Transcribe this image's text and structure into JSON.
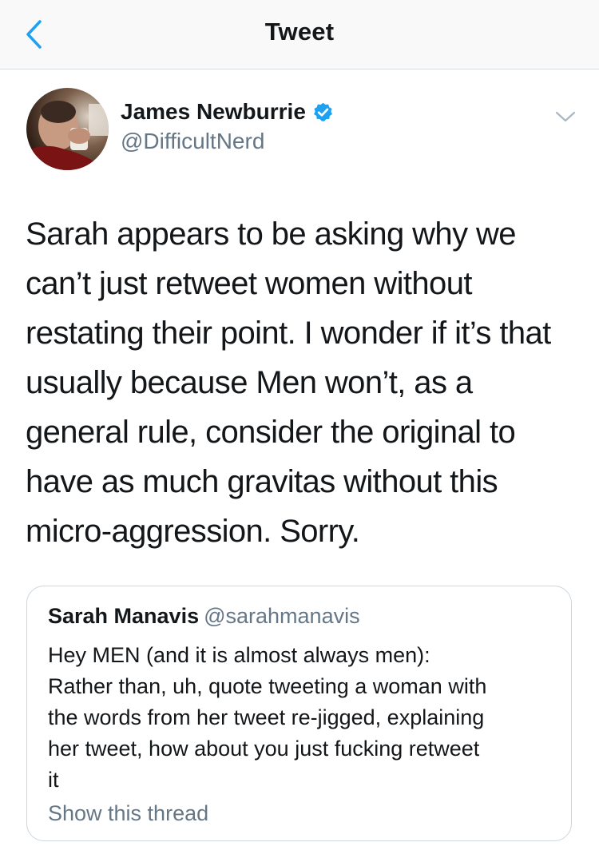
{
  "nav": {
    "title": "Tweet",
    "back_icon": "chevron-left-icon"
  },
  "tweet": {
    "author": {
      "name": "James Newburrie",
      "handle": "@DifficultNerd",
      "verified": true
    },
    "text": "Sarah appears to be asking why we\ncan’t just retweet women without\nrestating their point. I wonder if it’s that\nusually because Men won’t, as a\ngeneral rule, consider the original to\nhave as much gravitas without this\nmicro-aggression. Sorry."
  },
  "quoted_tweet": {
    "name": "Sarah Manavis",
    "handle": "@sarahmanavis",
    "text": "Hey MEN (and it is almost always men):\nRather than, uh, quote tweeting a woman with\nthe words from her tweet re-jigged, explaining\nher tweet, how about you just fucking retweet\nit",
    "show_thread_label": "Show this thread"
  },
  "colors": {
    "accent": "#1da1f2",
    "text_primary": "#14171a",
    "text_secondary": "#657786",
    "border": "#ccd6dd"
  }
}
